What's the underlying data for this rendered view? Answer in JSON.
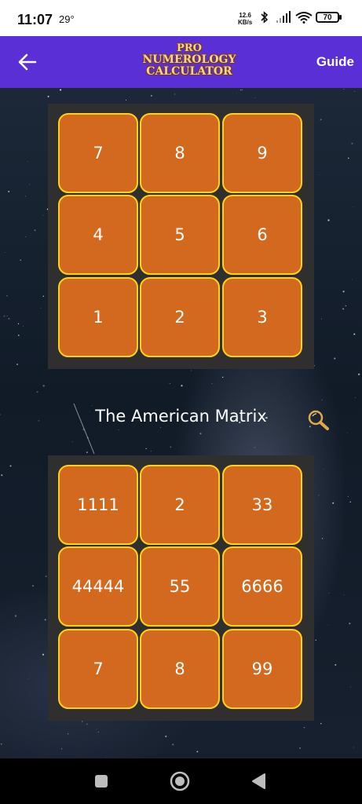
{
  "status_bar": {
    "time": "11:07",
    "temperature": "29°",
    "speed_value": "12.6",
    "speed_unit": "KB/s",
    "battery": "70",
    "icons": [
      "bluetooth-icon",
      "signal-icon",
      "wifi-icon",
      "battery-icon"
    ]
  },
  "app_bar": {
    "back_icon": "arrow-left-icon",
    "logo_lines": [
      "PRO",
      "NUMEROLOGY",
      "CALCULATOR"
    ],
    "guide_label": "Guide",
    "background_color": "#5b2fd6"
  },
  "grid1": {
    "cells": [
      "7",
      "8",
      "9",
      "4",
      "5",
      "6",
      "1",
      "2",
      "3"
    ]
  },
  "matrix": {
    "title": "The American Matrix",
    "search_icon": "magnifier-icon",
    "cells": [
      "1111",
      "2",
      "33",
      "44444",
      "55",
      "6666",
      "7",
      "8",
      "99"
    ]
  },
  "colors": {
    "cell_fill": "#d2691e",
    "cell_border": "#ffd21a",
    "panel_bg": "#2f2f2f",
    "accent": "#5b2fd6"
  },
  "nav_bar": {
    "icons": [
      "square-icon",
      "home-circle-icon",
      "back-triangle-icon"
    ]
  }
}
